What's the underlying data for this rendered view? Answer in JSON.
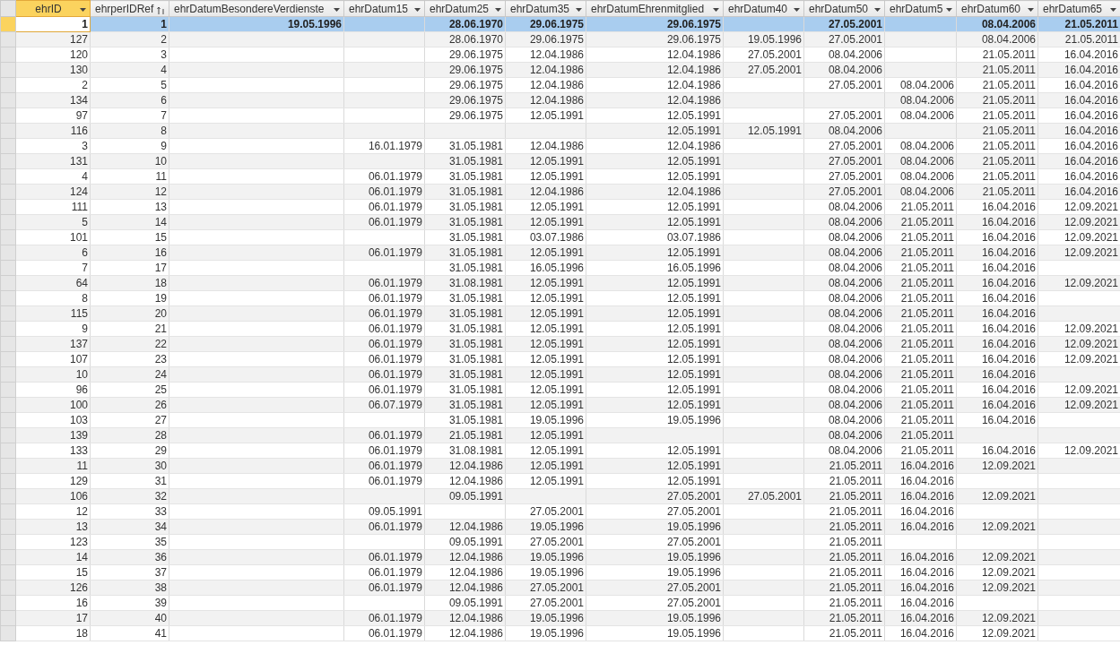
{
  "table": {
    "columns": [
      {
        "label": "ehrID",
        "selected": true,
        "sorted": false
      },
      {
        "label": "ehrperIDRef",
        "selected": false,
        "sorted": true
      },
      {
        "label": "ehrDatumBesondereVerdienste",
        "selected": false,
        "sorted": false
      },
      {
        "label": "ehrDatum15",
        "selected": false,
        "sorted": false
      },
      {
        "label": "ehrDatum25",
        "selected": false,
        "sorted": false
      },
      {
        "label": "ehrDatum35",
        "selected": false,
        "sorted": false
      },
      {
        "label": "ehrDatumEhrenmitglied",
        "selected": false,
        "sorted": false
      },
      {
        "label": "ehrDatum40",
        "selected": false,
        "sorted": false
      },
      {
        "label": "ehrDatum50",
        "selected": false,
        "sorted": false
      },
      {
        "label": "ehrDatum5",
        "selected": false,
        "sorted": false
      },
      {
        "label": "ehrDatum60",
        "selected": false,
        "sorted": false
      },
      {
        "label": "ehrDatum65",
        "selected": false,
        "sorted": false
      }
    ],
    "rows": [
      {
        "selected": true,
        "cells": [
          "1",
          "1",
          "19.05.1996",
          null,
          "28.06.1970",
          "29.06.1975",
          "29.06.1975",
          null,
          "27.05.2001",
          null,
          "08.04.2006",
          "21.05.2011"
        ]
      },
      {
        "selected": false,
        "cells": [
          "127",
          "2",
          null,
          null,
          "28.06.1970",
          "29.06.1975",
          "29.06.1975",
          "19.05.1996",
          "27.05.2001",
          null,
          "08.04.2006",
          "21.05.2011"
        ]
      },
      {
        "selected": false,
        "cells": [
          "120",
          "3",
          null,
          null,
          "29.06.1975",
          "12.04.1986",
          "12.04.1986",
          "27.05.2001",
          "08.04.2006",
          null,
          "21.05.2011",
          "16.04.2016"
        ]
      },
      {
        "selected": false,
        "cells": [
          "130",
          "4",
          null,
          null,
          "29.06.1975",
          "12.04.1986",
          "12.04.1986",
          "27.05.2001",
          "08.04.2006",
          null,
          "21.05.2011",
          "16.04.2016"
        ]
      },
      {
        "selected": false,
        "cells": [
          "2",
          "5",
          null,
          null,
          "29.06.1975",
          "12.04.1986",
          "12.04.1986",
          null,
          "27.05.2001",
          "08.04.2006",
          "21.05.2011",
          "16.04.2016"
        ]
      },
      {
        "selected": false,
        "cells": [
          "134",
          "6",
          null,
          null,
          "29.06.1975",
          "12.04.1986",
          "12.04.1986",
          null,
          null,
          "08.04.2006",
          "21.05.2011",
          "16.04.2016"
        ]
      },
      {
        "selected": false,
        "cells": [
          "97",
          "7",
          null,
          null,
          "29.06.1975",
          "12.05.1991",
          "12.05.1991",
          null,
          "27.05.2001",
          "08.04.2006",
          "21.05.2011",
          "16.04.2016"
        ]
      },
      {
        "selected": false,
        "cells": [
          "116",
          "8",
          null,
          null,
          null,
          null,
          "12.05.1991",
          "12.05.1991",
          "08.04.2006",
          null,
          "21.05.2011",
          "16.04.2016"
        ]
      },
      {
        "selected": false,
        "cells": [
          "3",
          "9",
          null,
          "16.01.1979",
          "31.05.1981",
          "12.04.1986",
          "12.04.1986",
          null,
          "27.05.2001",
          "08.04.2006",
          "21.05.2011",
          "16.04.2016"
        ]
      },
      {
        "selected": false,
        "cells": [
          "131",
          "10",
          null,
          null,
          "31.05.1981",
          "12.05.1991",
          "12.05.1991",
          null,
          "27.05.2001",
          "08.04.2006",
          "21.05.2011",
          "16.04.2016"
        ]
      },
      {
        "selected": false,
        "cells": [
          "4",
          "11",
          null,
          "06.01.1979",
          "31.05.1981",
          "12.05.1991",
          "12.05.1991",
          null,
          "27.05.2001",
          "08.04.2006",
          "21.05.2011",
          "16.04.2016"
        ]
      },
      {
        "selected": false,
        "cells": [
          "124",
          "12",
          null,
          "06.01.1979",
          "31.05.1981",
          "12.04.1986",
          "12.04.1986",
          null,
          "27.05.2001",
          "08.04.2006",
          "21.05.2011",
          "16.04.2016"
        ]
      },
      {
        "selected": false,
        "cells": [
          "111",
          "13",
          null,
          "06.01.1979",
          "31.05.1981",
          "12.05.1991",
          "12.05.1991",
          null,
          "08.04.2006",
          "21.05.2011",
          "16.04.2016",
          "12.09.2021"
        ]
      },
      {
        "selected": false,
        "cells": [
          "5",
          "14",
          null,
          "06.01.1979",
          "31.05.1981",
          "12.05.1991",
          "12.05.1991",
          null,
          "08.04.2006",
          "21.05.2011",
          "16.04.2016",
          "12.09.2021"
        ]
      },
      {
        "selected": false,
        "cells": [
          "101",
          "15",
          null,
          null,
          "31.05.1981",
          "03.07.1986",
          "03.07.1986",
          null,
          "08.04.2006",
          "21.05.2011",
          "16.04.2016",
          "12.09.2021"
        ]
      },
      {
        "selected": false,
        "cells": [
          "6",
          "16",
          null,
          "06.01.1979",
          "31.05.1981",
          "12.05.1991",
          "12.05.1991",
          null,
          "08.04.2006",
          "21.05.2011",
          "16.04.2016",
          "12.09.2021"
        ]
      },
      {
        "selected": false,
        "cells": [
          "7",
          "17",
          null,
          null,
          "31.05.1981",
          "16.05.1996",
          "16.05.1996",
          null,
          "08.04.2006",
          "21.05.2011",
          "16.04.2016",
          null
        ]
      },
      {
        "selected": false,
        "cells": [
          "64",
          "18",
          null,
          "06.01.1979",
          "31.08.1981",
          "12.05.1991",
          "12.05.1991",
          null,
          "08.04.2006",
          "21.05.2011",
          "16.04.2016",
          "12.09.2021"
        ]
      },
      {
        "selected": false,
        "cells": [
          "8",
          "19",
          null,
          "06.01.1979",
          "31.05.1981",
          "12.05.1991",
          "12.05.1991",
          null,
          "08.04.2006",
          "21.05.2011",
          "16.04.2016",
          null
        ]
      },
      {
        "selected": false,
        "cells": [
          "115",
          "20",
          null,
          "06.01.1979",
          "31.05.1981",
          "12.05.1991",
          "12.05.1991",
          null,
          "08.04.2006",
          "21.05.2011",
          "16.04.2016",
          null
        ]
      },
      {
        "selected": false,
        "cells": [
          "9",
          "21",
          null,
          "06.01.1979",
          "31.05.1981",
          "12.05.1991",
          "12.05.1991",
          null,
          "08.04.2006",
          "21.05.2011",
          "16.04.2016",
          "12.09.2021"
        ]
      },
      {
        "selected": false,
        "cells": [
          "137",
          "22",
          null,
          "06.01.1979",
          "31.05.1981",
          "12.05.1991",
          "12.05.1991",
          null,
          "08.04.2006",
          "21.05.2011",
          "16.04.2016",
          "12.09.2021"
        ]
      },
      {
        "selected": false,
        "cells": [
          "107",
          "23",
          null,
          "06.01.1979",
          "31.05.1981",
          "12.05.1991",
          "12.05.1991",
          null,
          "08.04.2006",
          "21.05.2011",
          "16.04.2016",
          "12.09.2021"
        ]
      },
      {
        "selected": false,
        "cells": [
          "10",
          "24",
          null,
          "06.01.1979",
          "31.05.1981",
          "12.05.1991",
          "12.05.1991",
          null,
          "08.04.2006",
          "21.05.2011",
          "16.04.2016",
          null
        ]
      },
      {
        "selected": false,
        "cells": [
          "96",
          "25",
          null,
          "06.01.1979",
          "31.05.1981",
          "12.05.1991",
          "12.05.1991",
          null,
          "08.04.2006",
          "21.05.2011",
          "16.04.2016",
          "12.09.2021"
        ]
      },
      {
        "selected": false,
        "cells": [
          "100",
          "26",
          null,
          "06.07.1979",
          "31.05.1981",
          "12.05.1991",
          "12.05.1991",
          null,
          "08.04.2006",
          "21.05.2011",
          "16.04.2016",
          "12.09.2021"
        ]
      },
      {
        "selected": false,
        "cells": [
          "103",
          "27",
          null,
          null,
          "31.05.1981",
          "19.05.1996",
          "19.05.1996",
          null,
          "08.04.2006",
          "21.05.2011",
          "16.04.2016",
          null
        ]
      },
      {
        "selected": false,
        "cells": [
          "139",
          "28",
          null,
          "06.01.1979",
          "21.05.1981",
          "12.05.1991",
          null,
          null,
          "08.04.2006",
          "21.05.2011",
          null,
          null
        ]
      },
      {
        "selected": false,
        "cells": [
          "133",
          "29",
          null,
          "06.01.1979",
          "31.08.1981",
          "12.05.1991",
          "12.05.1991",
          null,
          "08.04.2006",
          "21.05.2011",
          "16.04.2016",
          "12.09.2021"
        ]
      },
      {
        "selected": false,
        "cells": [
          "11",
          "30",
          null,
          "06.01.1979",
          "12.04.1986",
          "12.05.1991",
          "12.05.1991",
          null,
          "21.05.2011",
          "16.04.2016",
          "12.09.2021",
          null
        ]
      },
      {
        "selected": false,
        "cells": [
          "129",
          "31",
          null,
          "06.01.1979",
          "12.04.1986",
          "12.05.1991",
          "12.05.1991",
          null,
          "21.05.2011",
          "16.04.2016",
          null,
          null
        ]
      },
      {
        "selected": false,
        "cells": [
          "106",
          "32",
          null,
          null,
          "09.05.1991",
          null,
          "27.05.2001",
          "27.05.2001",
          "21.05.2011",
          "16.04.2016",
          "12.09.2021",
          null
        ]
      },
      {
        "selected": false,
        "cells": [
          "12",
          "33",
          null,
          "09.05.1991",
          null,
          "27.05.2001",
          "27.05.2001",
          null,
          "21.05.2011",
          "16.04.2016",
          null,
          null
        ]
      },
      {
        "selected": false,
        "cells": [
          "13",
          "34",
          null,
          "06.01.1979",
          "12.04.1986",
          "19.05.1996",
          "19.05.1996",
          null,
          "21.05.2011",
          "16.04.2016",
          "12.09.2021",
          null
        ]
      },
      {
        "selected": false,
        "cells": [
          "123",
          "35",
          null,
          null,
          "09.05.1991",
          "27.05.2001",
          "27.05.2001",
          null,
          "21.05.2011",
          null,
          null,
          null
        ]
      },
      {
        "selected": false,
        "cells": [
          "14",
          "36",
          null,
          "06.01.1979",
          "12.04.1986",
          "19.05.1996",
          "19.05.1996",
          null,
          "21.05.2011",
          "16.04.2016",
          "12.09.2021",
          null
        ]
      },
      {
        "selected": false,
        "cells": [
          "15",
          "37",
          null,
          "06.01.1979",
          "12.04.1986",
          "19.05.1996",
          "19.05.1996",
          null,
          "21.05.2011",
          "16.04.2016",
          "12.09.2021",
          null
        ]
      },
      {
        "selected": false,
        "cells": [
          "126",
          "38",
          null,
          "06.01.1979",
          "12.04.1986",
          "27.05.2001",
          "27.05.2001",
          null,
          "21.05.2011",
          "16.04.2016",
          "12.09.2021",
          null
        ]
      },
      {
        "selected": false,
        "cells": [
          "16",
          "39",
          null,
          null,
          "09.05.1991",
          "27.05.2001",
          "27.05.2001",
          null,
          "21.05.2011",
          "16.04.2016",
          null,
          null
        ]
      },
      {
        "selected": false,
        "cells": [
          "17",
          "40",
          null,
          "06.01.1979",
          "12.04.1986",
          "19.05.1996",
          "19.05.1996",
          null,
          "21.05.2011",
          "16.04.2016",
          "12.09.2021",
          null
        ]
      },
      {
        "selected": false,
        "cells": [
          "18",
          "41",
          null,
          "06.01.1979",
          "12.04.1986",
          "19.05.1996",
          "19.05.1996",
          null,
          "21.05.2011",
          "16.04.2016",
          "12.09.2021",
          null
        ]
      }
    ]
  }
}
